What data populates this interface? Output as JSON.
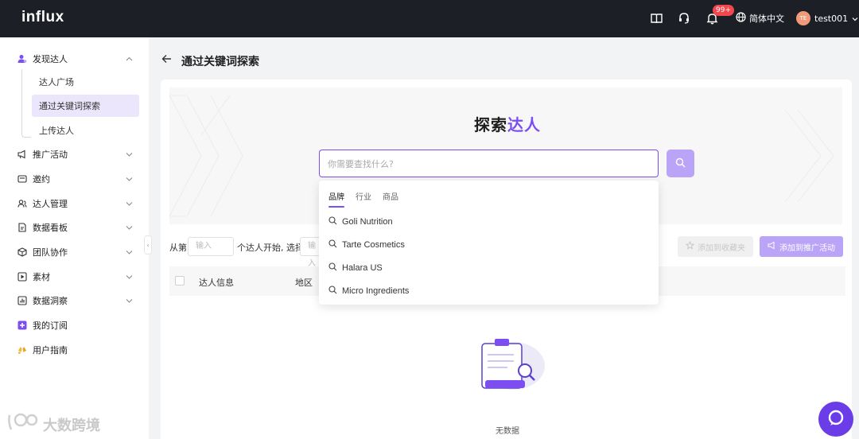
{
  "app": {
    "logo": "influx"
  },
  "topbar": {
    "notification_badge": "99+",
    "language": "简体中文",
    "user_initials": "TE",
    "username": "test001"
  },
  "sidebar": {
    "items": [
      {
        "label": "发现达人",
        "icon": "user-icon",
        "expanded": true
      },
      {
        "label": "推广活动",
        "icon": "megaphone-icon"
      },
      {
        "label": "邀约",
        "icon": "mail-icon"
      },
      {
        "label": "达人管理",
        "icon": "users-icon"
      },
      {
        "label": "数据看板",
        "icon": "document-icon"
      },
      {
        "label": "团队协作",
        "icon": "cube-icon"
      },
      {
        "label": "素材",
        "icon": "play-icon"
      },
      {
        "label": "数据洞察",
        "icon": "chart-icon"
      },
      {
        "label": "我的订阅",
        "icon": "subscription-icon"
      },
      {
        "label": "用户指南",
        "icon": "hands-icon"
      }
    ],
    "sub_items": [
      "达人广场",
      "通过关键词探索",
      "上传达人"
    ],
    "active_sub": "通过关键词探索"
  },
  "page": {
    "title": "通过关键词探索"
  },
  "hero": {
    "title_prefix": "探索",
    "title_accent": "达人",
    "search_placeholder": "你需要查找什么?"
  },
  "dropdown": {
    "tabs": [
      "品牌",
      "行业",
      "商品"
    ],
    "active_tab": "品牌",
    "suggestions": [
      "Goli Nutrition",
      "Tarte Cosmetics",
      "Halara US",
      "Micro Ingredients"
    ]
  },
  "filters": {
    "from_label": "从第",
    "input_placeholder": "输入",
    "mid_label": "个达人开始, 选择",
    "input2_placeholder": "输入",
    "fav_button": "添加到收藏夹",
    "add_button": "添加到推广活动"
  },
  "table": {
    "columns": [
      "达人信息",
      "地区"
    ]
  },
  "empty": {
    "text": "无数据"
  },
  "watermark": "大数跨境",
  "colors": {
    "accent": "#7c4ef2",
    "accent_light": "#b9a4f7",
    "topbar": "#1d1f26",
    "badge": "#f5454d"
  }
}
